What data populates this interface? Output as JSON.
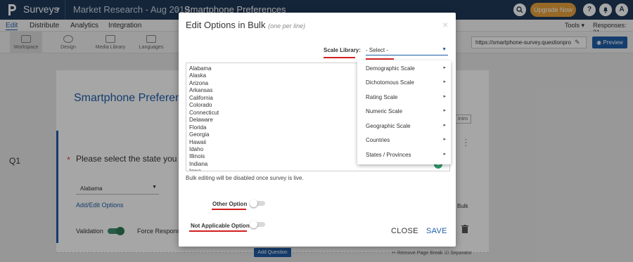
{
  "header": {
    "brand": "Surveys",
    "survey_name": "Market Research - Aug 2019",
    "breadcrumb_sep": ">",
    "page_name": "Smartphone Preferences",
    "upgrade_label": "Upgrade Now",
    "help_icon": "?",
    "avatar_letter": "A"
  },
  "menu": {
    "items": [
      "Edit",
      "Distribute",
      "Analytics",
      "Integration"
    ],
    "tools_label": "Tools",
    "responses_label": "Responses: 21"
  },
  "toolbar": {
    "items": [
      "Workspace",
      "Design",
      "Media Library",
      "Languages"
    ],
    "survey_url": "https://smartphone-survey.questionpro",
    "preview_label": "Preview"
  },
  "survey": {
    "title": "Smartphone Preference",
    "intro_button": "Intro",
    "question_number": "Q1",
    "required_marker": "*",
    "question_text": "Please select the state you li",
    "answer_value": "Alabama",
    "add_edit_options": "Add/Edit Options",
    "bulk_label": "Bulk",
    "validation_label": "Validation",
    "force_response_label": "Force Response",
    "add_question_label": "Add Question",
    "remove_page_break_label": "Remove Page Break",
    "separator_label": "Separator"
  },
  "modal": {
    "title": "Edit Options in Bulk",
    "subtitle": "(one per line)",
    "close_symbol": "×",
    "scale_library_label": "Scale Library:",
    "scale_select_value": "- Select -",
    "options": [
      "Alabama",
      "Alaska",
      "Arizona",
      "Arkansas",
      "California",
      "Colorado",
      "Connecticut",
      "Delaware",
      "Florida",
      "Georgia",
      "Hawaii",
      "Idaho",
      "Illinois",
      "Indiana",
      "Iowa"
    ],
    "bulk_note": "Bulk editing will be disabled once survey is live.",
    "other_option_label": "Other Option",
    "not_applicable_label": "Not Applicable Option",
    "close_label": "CLOSE",
    "save_label": "SAVE"
  },
  "scale_dropdown": {
    "items": [
      "Demographic Scale",
      "Dichotomous Scale",
      "Rating Scale",
      "Numeric Scale",
      "Geographic Scale",
      "Countries",
      "States / Provinces"
    ]
  },
  "colors": {
    "header_bg": "#1f3a5a",
    "accent_blue": "#1f5ea8",
    "upgrade_orange": "#e9a23b",
    "highlight_red": "#d21f1f"
  }
}
